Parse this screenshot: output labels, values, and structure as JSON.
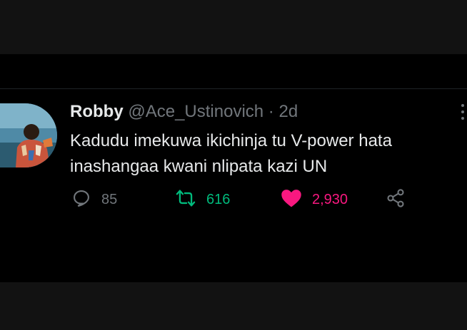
{
  "tweet": {
    "author_name": "Robby",
    "handle": "@Ace_Ustinovich",
    "separator": "·",
    "time": "2d",
    "text": "Kadudu imekuwa ikichinja tu V-power hata inashangaa kwani nlipata kazi UN",
    "replies": "85",
    "retweets": "616",
    "likes": "2,930"
  },
  "icons": {
    "reply": "reply-icon",
    "retweet": "retweet-icon",
    "like": "heart-icon",
    "share": "share-icon",
    "more": "more-icon"
  },
  "colors": {
    "background": "#000000",
    "band": "#121212",
    "text_primary": "#e7e9ea",
    "text_secondary": "#71767b",
    "retweet_active": "#00ba7c",
    "like_active": "#f91880"
  }
}
